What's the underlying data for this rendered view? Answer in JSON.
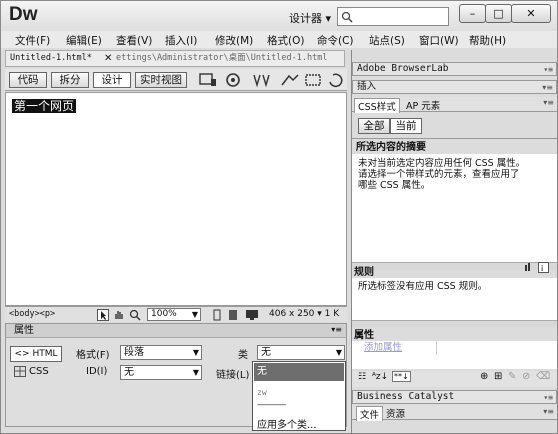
{
  "app": {
    "logo": "Dw",
    "workspace": "设计器 ▾",
    "win_min": "–",
    "win_max": "□",
    "win_close": "✕"
  },
  "menu": [
    "文件(F)",
    "编辑(E)",
    "查看(V)",
    "插入(I)",
    "修改(M)",
    "格式(O)",
    "命令(C)",
    "站点(S)",
    "窗口(W)",
    "帮助(H)"
  ],
  "document": {
    "tab_title": "Untitled-1.html*",
    "tab_close": "✕",
    "path": "ettings\\Administrator\\桌面\\Untitled-1.html"
  },
  "views": [
    "代码",
    "拆分",
    "设计",
    "实时视图"
  ],
  "design_text": "第一个网页",
  "status": {
    "tags": "<body><p>",
    "zoom": "100%",
    "size": "406 x 250 ▾ 1 K"
  },
  "properties": {
    "title": "属性",
    "html_btn": "<> HTML",
    "css_btn": "CSS",
    "format_label": "格式(F)",
    "format_value": "段落",
    "class_label": "类",
    "class_value": "无",
    "id_label": "ID(I)",
    "id_value": "无",
    "link_label": "链接(L)",
    "class_options": [
      "无",
      "zw",
      "---------------",
      "应用多个类..."
    ]
  },
  "right": {
    "browserlab": "Adobe BrowserLab",
    "insert": "插入",
    "css_tabs": [
      "CSS样式",
      "AP 元素"
    ],
    "mode_tabs": [
      "全部",
      "当前"
    ],
    "summary_title": "所选内容的摘要",
    "summary_text": [
      "未对当前选定内容应用任何 CSS 属性。",
      "请选择一个带样式的元素，查看应用了",
      "哪些 CSS 属性。"
    ],
    "rules_title": "规则",
    "rules_text": "所选标签没有应用 CSS 规则。",
    "props_title": "属性",
    "add_property": "添加属性",
    "bc": "Business Catalyst",
    "files_tabs": [
      "文件",
      "资源"
    ]
  }
}
